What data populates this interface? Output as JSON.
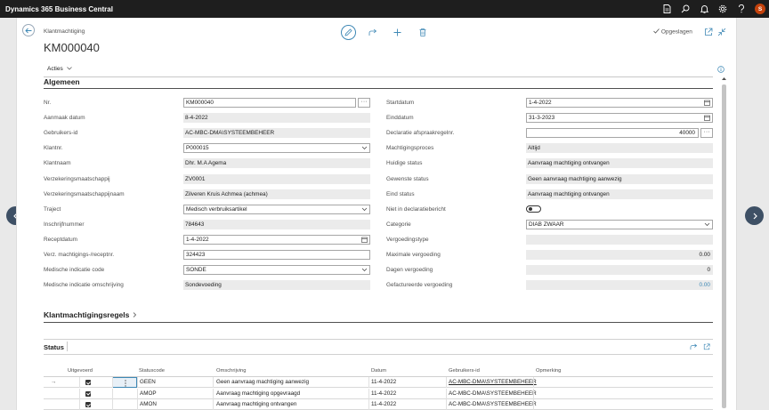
{
  "app": {
    "title": "Dynamics 365 Business Central",
    "user_initial": "S"
  },
  "header": {
    "breadcrumb": "Klantmachtiging",
    "record_title": "KM000040",
    "saved_label": "Opgeslagen",
    "actions_label": "Acties"
  },
  "general": {
    "section_title": "Algemeen",
    "left": [
      {
        "label": "Nr.",
        "value": "KM000040"
      },
      {
        "label": "Aanmaak datum",
        "value": "8-4-2022"
      },
      {
        "label": "Gebruikers-id",
        "value": "AC-MBC-DMA\\SYSTEEMBEHEER"
      },
      {
        "label": "Klantnr.",
        "value": "P000015"
      },
      {
        "label": "Klantnaam",
        "value": "Dhr. M.A Agema"
      },
      {
        "label": "Verzekeringsmaatschappij",
        "value": "ZV0001"
      },
      {
        "label": "Verzekeringsmaatschappijnaam",
        "value": "Zilveren Kruis Achmea (achmea)"
      },
      {
        "label": "Traject",
        "value": "Medisch verbruiksartikel"
      },
      {
        "label": "Inschrijfnummer",
        "value": "784643"
      },
      {
        "label": "Receptdatum",
        "value": "1-4-2022"
      },
      {
        "label": "Verz. machtigings-/receptnr.",
        "value": "324423"
      },
      {
        "label": "Medische indicatie code",
        "value": "SONDE"
      },
      {
        "label": "Medische indicatie omschrijving",
        "value": "Sondevoeding"
      }
    ],
    "right": [
      {
        "label": "Startdatum",
        "value": "1-4-2022"
      },
      {
        "label": "Einddatum",
        "value": "31-3-2023"
      },
      {
        "label": "Declaratie afspraakregelnr.",
        "value": "40000"
      },
      {
        "label": "Machtigingsproces",
        "value": "Altijd"
      },
      {
        "label": "Huidige status",
        "value": "Aanvraag machtiging ontvangen"
      },
      {
        "label": "Gewenste status",
        "value": "Geen aanvraag machtiging aanwezig"
      },
      {
        "label": "Eind status",
        "value": "Aanvraag machtiging ontvangen"
      },
      {
        "label": "Niet in declaratiebericht",
        "value": ""
      },
      {
        "label": "Categorie",
        "value": "DIAB ZWAAR"
      },
      {
        "label": "Vergoedingstype",
        "value": ""
      },
      {
        "label": "Maximale vergoeding",
        "value": "0.00"
      },
      {
        "label": "Dagen vergoeding",
        "value": "0"
      },
      {
        "label": "Gefactureerde vergoeding",
        "value": "0.00"
      }
    ]
  },
  "lines_section": {
    "title": "Klantmachtigingsregels"
  },
  "status": {
    "title": "Status",
    "columns": {
      "uitgevoerd": "Uitgevoerd",
      "statuscode": "Statuscode",
      "omschrijving": "Omschrijving",
      "datum": "Datum",
      "gebruiker": "Gebruikers-id",
      "opmerking": "Opmerking"
    },
    "rows": [
      {
        "code": "GEEN",
        "desc": "Geen aanvraag machtiging aanwezig",
        "date": "11-4-2022",
        "user": "AC-MBC-DMA\\SYSTEEMBEHEER",
        "note": "",
        "done": true,
        "current": true
      },
      {
        "code": "AMOP",
        "desc": "Aanvraag machtiging opgevraagd",
        "date": "11-4-2022",
        "user": "AC-MBC-DMA\\SYSTEEMBEHEER",
        "note": "",
        "done": true,
        "current": false
      },
      {
        "code": "AMON",
        "desc": "Aanvraag machtiging ontvangen",
        "date": "11-4-2022",
        "user": "AC-MBC-DMA\\SYSTEEMBEHEER",
        "note": "",
        "done": true,
        "current": false
      }
    ]
  },
  "colors": {
    "topbar": "#1e1e1e",
    "accent": "#3e88b5",
    "avatar": "#c4420c",
    "nav_arrow": "#3e5065"
  }
}
